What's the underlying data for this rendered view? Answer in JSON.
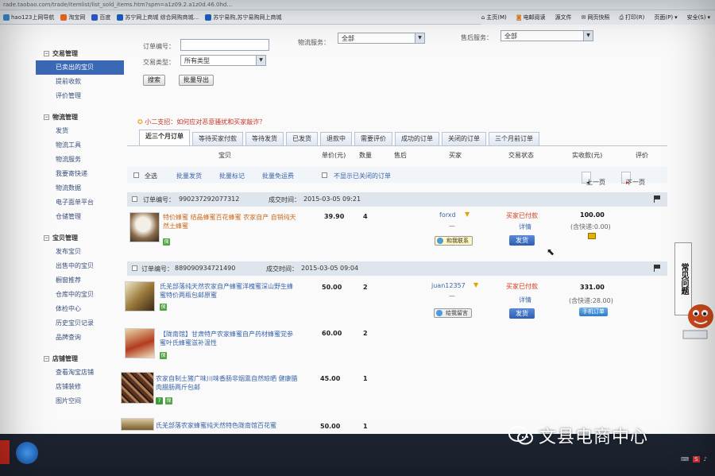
{
  "browser": {
    "address": "rade.taobao.com/trade/itemlist/list_sold_items.htm?spm=a1z09.2.a1z0d.46.0hd...",
    "favorites": [
      {
        "label": "hao123上网导航",
        "color": "#3f8fd6"
      },
      {
        "label": "淘宝网",
        "color": "#f06b1e"
      },
      {
        "label": "百度",
        "color": "#2e5bd0"
      },
      {
        "label": "苏宁网上商城 综合网购商城...",
        "color": "#1b62c6"
      },
      {
        "label": "苏宁易购,苏宁易购网上商城",
        "color": "#1b62c6"
      }
    ],
    "tools": [
      "主页(M)",
      "电邮阅读",
      "源文件",
      "网页快照",
      "打印(R)",
      "页面(P)",
      "安全(S)"
    ]
  },
  "search_form": {
    "order_no_label": "订单编号：",
    "order_no_value": "",
    "logistics_label": "物流服务：",
    "logistics_value": "全部",
    "aftersale_label": "售后服务：",
    "aftersale_value": "全部",
    "trade_type_label": "交易类型：",
    "trade_type_value": "所有类型",
    "search_button": "搜索",
    "export_button": "批量导出"
  },
  "sidebar": {
    "sections": [
      {
        "title": "交易管理",
        "items": [
          "已卖出的宝贝",
          "提前收款",
          "评价管理"
        ],
        "active": 0
      },
      {
        "title": "物流管理",
        "items": [
          "发货",
          "物流工具",
          "物流服务",
          "我要寄快递",
          "物流数据",
          "电子面单平台",
          "仓储管理"
        ]
      },
      {
        "title": "宝贝管理",
        "items": [
          "发布宝贝",
          "出售中的宝贝",
          "橱窗推荐",
          "仓库中的宝贝",
          "体检中心",
          "历史宝贝记录",
          "品牌查询"
        ]
      },
      {
        "title": "店铺管理",
        "items": [
          "查看淘宝店铺",
          "店铺装修",
          "图片空间"
        ]
      }
    ]
  },
  "notice": "小二支招：如何应对恶意骚扰和买家敲诈？",
  "tabs": [
    "近三个月订单",
    "等待买家付款",
    "等待发货",
    "已发货",
    "退款中",
    "需要评价",
    "成功的订单",
    "关闭的订单",
    "三个月前订单"
  ],
  "table_header": {
    "item": "宝贝",
    "unit_price": "单价(元)",
    "quantity": "数量",
    "aftersale": "售后",
    "buyer": "买家",
    "trade_status": "交易状态",
    "received": "实收款(元)",
    "review": "评价"
  },
  "bulk_actions": {
    "select_all": "全选",
    "bulk_ship": "批量发货",
    "bulk_mark": "批量标记",
    "bulk_free_ship": "批量免运费",
    "hide_closed": "不显示已关闭的订单",
    "prev_page": "上一页",
    "next_page": "下一页"
  },
  "orders": [
    {
      "order_no_label": "订单编号：",
      "order_no": "990237292077312",
      "time_label": "成交时间：",
      "time": "2015-03-05 09:21",
      "buyer": "forxd",
      "chat_label": "和我联系",
      "status": "买家已付款",
      "detail": "详情",
      "action": "发货",
      "total": "100.00",
      "shipping": "(含快递:0.00)",
      "items": [
        {
          "name": "特价蜂蜜 结晶蜂蜜百花蜂蜜 农家自产 自销纯天然土蜂蜜",
          "price": "39.90",
          "qty": "4"
        }
      ]
    },
    {
      "order_no_label": "订单编号：",
      "order_no": "889090934721490",
      "time_label": "成交时间：",
      "time": "2015-03-05 09:04",
      "buyer": "juan12357",
      "chat_label": "给我留言",
      "status": "买家已付款",
      "detail": "详情",
      "action": "发货",
      "total": "331.00",
      "shipping": "(含快递:28.00)",
      "mobile_badge": "手机订单",
      "items": [
        {
          "name": "氏羌部落纯天然农家自产蜂蜜洋槐蜜深山野生蜂蜜特价两瓶包邮原蜜",
          "price": "50.00",
          "qty": "2"
        },
        {
          "name": "【陇南馆】甘肃特产农家蜂蜜自产药材蜂蜜党参蜜叶氏蜂蜜滋补温性",
          "price": "60.00",
          "qty": "2"
        },
        {
          "name": "农家自制土猪广味川味香肠非烟熏自然晾晒 健康腊肉腊肠两斤包邮",
          "price": "45.00",
          "qty": "1"
        },
        {
          "name": "氏羌部落农家蜂蜜纯天然特色陇南馆百花蜜",
          "price": "50.00",
          "qty": "1"
        }
      ]
    }
  ],
  "help": "常见问题",
  "watermark": "文县电商中心",
  "colors": {
    "accent_blue": "#3b68b5",
    "status_red": "#d4391f",
    "link_blue": "#3a64a8"
  }
}
